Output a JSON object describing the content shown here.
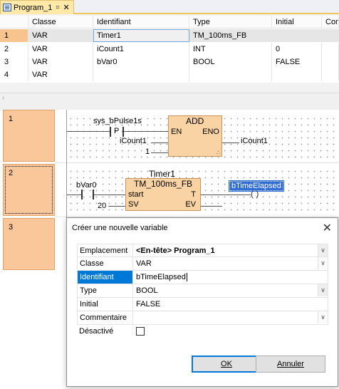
{
  "tab": {
    "title": "Program_1",
    "pin": "⌗",
    "close": "✕"
  },
  "grid": {
    "headers": [
      "Classe",
      "Identifiant",
      "Type",
      "Initial",
      "Com"
    ],
    "rows": [
      {
        "num": "1",
        "classe": "VAR",
        "identifiant": "Timer1",
        "type": "TM_100ms_FB",
        "initial": ""
      },
      {
        "num": "2",
        "classe": "VAR",
        "identifiant": "iCount1",
        "type": "INT",
        "initial": "0"
      },
      {
        "num": "3",
        "classe": "VAR",
        "identifiant": "bVar0",
        "type": "BOOL",
        "initial": "FALSE"
      },
      {
        "num": "4",
        "classe": "VAR",
        "identifiant": "",
        "type": "",
        "initial": ""
      }
    ]
  },
  "ladder": {
    "rung1": {
      "num": "1",
      "contact_var": "sys_bPulse1s",
      "contact_mark": "P",
      "block": "ADD",
      "pin_en": "EN",
      "pin_eno": "ENO",
      "in1": "iCount1",
      "in2": "1",
      "out": "iCount1"
    },
    "rung2": {
      "num": "2",
      "instance": "Timer1",
      "block": "TM_100ms_FB",
      "contact_var": "bVar0",
      "pin_start": "start",
      "pin_sv": "SV",
      "pin_t": "T",
      "pin_ev": "EV",
      "sv_value": "20",
      "coil_var": "bTimeElapsed",
      "coil_glyph": "( )"
    },
    "rung3": {
      "num": "3"
    }
  },
  "dialog": {
    "title": "Créer une nouvelle variable",
    "close": "✕",
    "fields": [
      {
        "label": "Emplacement",
        "value_strong": "<En-tête> Program_1",
        "dropdown": true
      },
      {
        "label": "Classe",
        "value": "VAR",
        "dropdown": true
      },
      {
        "label": "Identifiant",
        "value": "bTimeElapsed",
        "active": true
      },
      {
        "label": "Type",
        "value": "BOOL",
        "dropdown": true
      },
      {
        "label": "Initial",
        "value": "FALSE"
      },
      {
        "label": "Commentaire",
        "value": "",
        "dropdown": true
      },
      {
        "label": "Désactivé",
        "checkbox": false
      }
    ],
    "ok_label": "OK",
    "cancel_label": "Annuler"
  }
}
